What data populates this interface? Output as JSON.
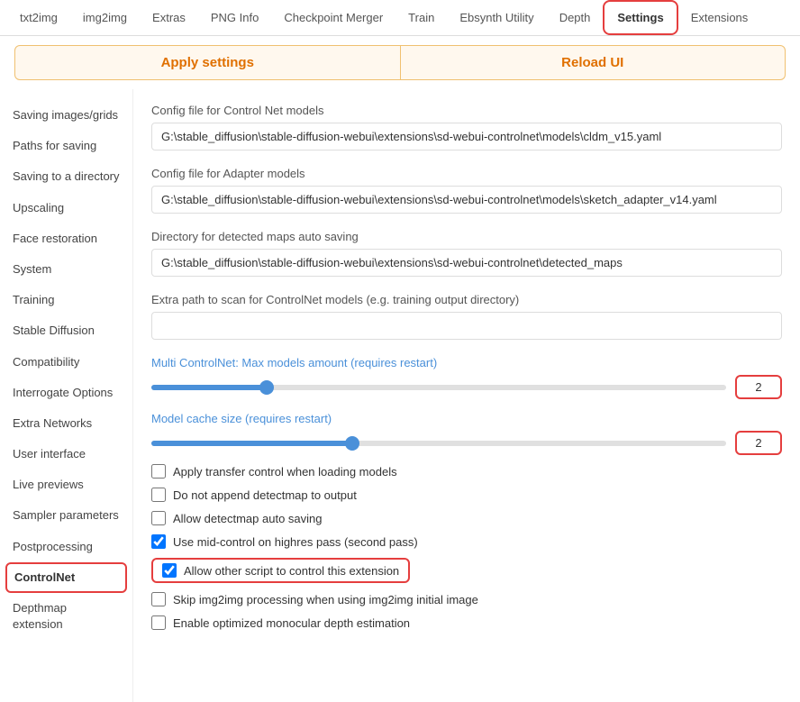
{
  "nav": {
    "items": [
      {
        "label": "txt2img",
        "active": false
      },
      {
        "label": "img2img",
        "active": false
      },
      {
        "label": "Extras",
        "active": false
      },
      {
        "label": "PNG Info",
        "active": false
      },
      {
        "label": "Checkpoint Merger",
        "active": false
      },
      {
        "label": "Train",
        "active": false
      },
      {
        "label": "Ebsynth Utility",
        "active": false
      },
      {
        "label": "Depth",
        "active": false
      },
      {
        "label": "Settings",
        "active": true
      },
      {
        "label": "Extensions",
        "active": false
      }
    ]
  },
  "actions": {
    "apply_label": "Apply settings",
    "reload_label": "Reload UI"
  },
  "sidebar": {
    "items": [
      {
        "label": "Saving images/grids",
        "active": false
      },
      {
        "label": "Paths for saving",
        "active": false
      },
      {
        "label": "Saving to a directory",
        "active": false
      },
      {
        "label": "Upscaling",
        "active": false
      },
      {
        "label": "Face restoration",
        "active": false
      },
      {
        "label": "System",
        "active": false
      },
      {
        "label": "Training",
        "active": false
      },
      {
        "label": "Stable Diffusion",
        "active": false
      },
      {
        "label": "Compatibility",
        "active": false
      },
      {
        "label": "Interrogate Options",
        "active": false
      },
      {
        "label": "Extra Networks",
        "active": false
      },
      {
        "label": "User interface",
        "active": false
      },
      {
        "label": "Live previews",
        "active": false
      },
      {
        "label": "Sampler parameters",
        "active": false
      },
      {
        "label": "Postprocessing",
        "active": false
      },
      {
        "label": "ControlNet",
        "active": true
      },
      {
        "label": "Depthmap extension",
        "active": false
      }
    ]
  },
  "content": {
    "config_controlnet_label": "Config file for Control Net models",
    "config_controlnet_value": "G:\\stable_diffusion\\stable-diffusion-webui\\extensions\\sd-webui-controlnet\\models\\cldm_v15.yaml",
    "config_adapter_label": "Config file for Adapter models",
    "config_adapter_value": "G:\\stable_diffusion\\stable-diffusion-webui\\extensions\\sd-webui-controlnet\\models\\sketch_adapter_v14.yaml",
    "dir_detected_label": "Directory for detected maps auto saving",
    "dir_detected_value": "G:\\stable_diffusion\\stable-diffusion-webui\\extensions\\sd-webui-controlnet\\detected_maps",
    "extra_path_label": "Extra path to scan for ControlNet models (e.g. training output directory)",
    "extra_path_value": "",
    "multi_controlnet_label": "Multi ControlNet: Max models amount (requires restart)",
    "multi_controlnet_value": "2",
    "multi_controlnet_percent": 20,
    "model_cache_label": "Model cache size (requires restart)",
    "model_cache_value": "2",
    "model_cache_percent": 35,
    "checkboxes": [
      {
        "label": "Apply transfer control when loading models",
        "checked": false,
        "highlighted": false
      },
      {
        "label": "Do not append detectmap to output",
        "checked": false,
        "highlighted": false
      },
      {
        "label": "Allow detectmap auto saving",
        "checked": false,
        "highlighted": false
      },
      {
        "label": "Use mid-control on highres pass (second pass)",
        "checked": true,
        "highlighted": false
      },
      {
        "label": "Allow other script to control this extension",
        "checked": true,
        "highlighted": true
      },
      {
        "label": "Skip img2img processing when using img2img initial image",
        "checked": false,
        "highlighted": false
      },
      {
        "label": "Enable optimized monocular depth estimation",
        "checked": false,
        "highlighted": false
      }
    ]
  }
}
